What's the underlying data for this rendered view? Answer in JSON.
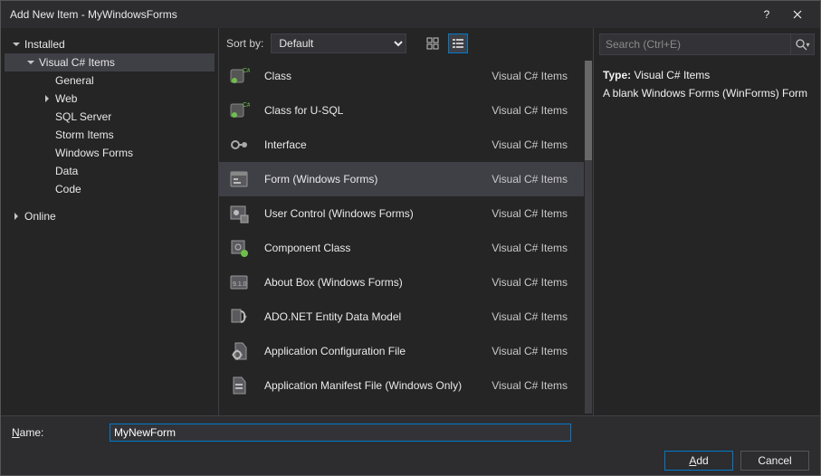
{
  "window": {
    "title": "Add New Item - MyWindowsForms"
  },
  "tree": {
    "installed": "Installed",
    "vcs_items": "Visual C# Items",
    "children": [
      "General",
      "Web",
      "SQL Server",
      "Storm Items",
      "Windows Forms",
      "Data",
      "Code"
    ],
    "online": "Online"
  },
  "sort": {
    "label": "Sort by:",
    "value": "Default"
  },
  "items": [
    {
      "name": "Class",
      "cat": "Visual C# Items",
      "icon": "class"
    },
    {
      "name": "Class for U-SQL",
      "cat": "Visual C# Items",
      "icon": "class"
    },
    {
      "name": "Interface",
      "cat": "Visual C# Items",
      "icon": "interface"
    },
    {
      "name": "Form (Windows Forms)",
      "cat": "Visual C# Items",
      "icon": "form",
      "selected": true
    },
    {
      "name": "User Control (Windows Forms)",
      "cat": "Visual C# Items",
      "icon": "usercontrol"
    },
    {
      "name": "Component Class",
      "cat": "Visual C# Items",
      "icon": "component"
    },
    {
      "name": "About Box (Windows Forms)",
      "cat": "Visual C# Items",
      "icon": "about"
    },
    {
      "name": "ADO.NET Entity Data Model",
      "cat": "Visual C# Items",
      "icon": "ado"
    },
    {
      "name": "Application Configuration File",
      "cat": "Visual C# Items",
      "icon": "config"
    },
    {
      "name": "Application Manifest File (Windows Only)",
      "cat": "Visual C# Items",
      "icon": "manifest"
    }
  ],
  "search": {
    "placeholder": "Search (Ctrl+E)"
  },
  "info": {
    "type_label": "Type:",
    "type_value": "Visual C# Items",
    "description": "A blank Windows Forms (WinForms) Form"
  },
  "name_field": {
    "label_prefix": "N",
    "label_rest": "ame:",
    "value": "MyNewForm"
  },
  "buttons": {
    "add_prefix": "A",
    "add_rest": "dd",
    "cancel": "Cancel"
  }
}
